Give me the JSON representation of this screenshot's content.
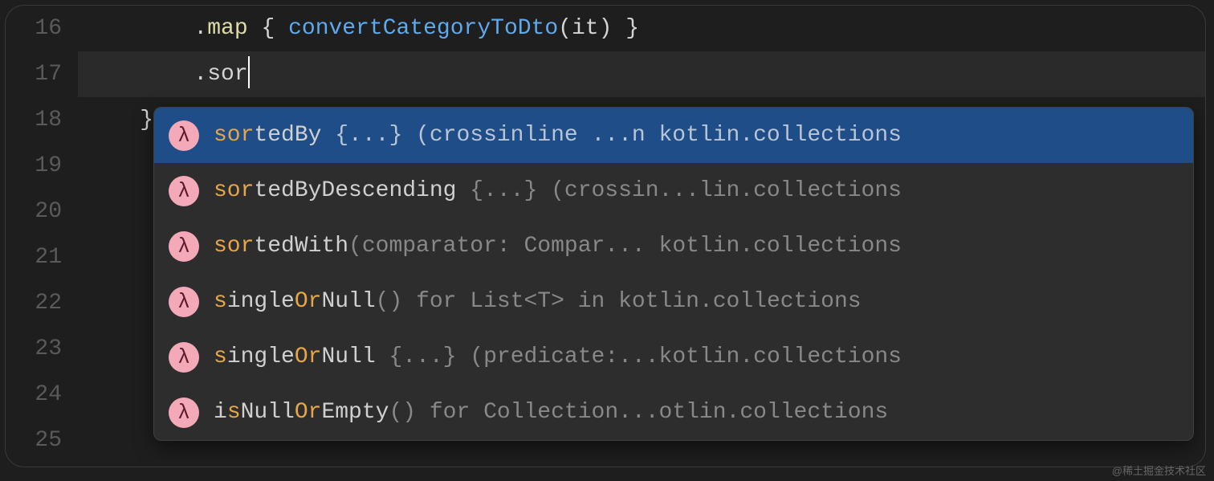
{
  "line_numbers": [
    "16",
    "17",
    "18",
    "19",
    "20",
    "21",
    "22",
    "23",
    "24",
    "25"
  ],
  "code": {
    "line16": {
      "indent": "        ",
      "dot": ".",
      "method": "map",
      "space": " ",
      "lbrace": "{",
      "space2": " ",
      "func": "convertCategoryToDto",
      "lparen": "(",
      "param": "it",
      "rparen": ")",
      "space3": " ",
      "rbrace": "}"
    },
    "line17": {
      "indent": "        ",
      "dot": ".",
      "typed": "sor"
    },
    "line18": {
      "indent": "    ",
      "brace": "}"
    }
  },
  "popup": {
    "lambda_glyph": "λ",
    "items": [
      {
        "match": "sor",
        "rest": "tedBy",
        "sig": " {...} (crossinline ...n kotlin.collections",
        "selected": true
      },
      {
        "match": "sor",
        "rest": "tedByDescending",
        "sig": " {...} (crossin...lin.collections",
        "selected": false
      },
      {
        "match": "sor",
        "rest": "tedWith",
        "sig": "(comparator: Compar... kotlin.collections",
        "selected": false
      },
      {
        "match_parts": [
          "s",
          "ingle",
          "O",
          "r",
          "Null"
        ],
        "match_flags": [
          true,
          false,
          true,
          true,
          false
        ],
        "sig": "() for List<T> in kotlin.collections",
        "selected": false
      },
      {
        "match_parts": [
          "s",
          "ingle",
          "O",
          "r",
          "Null"
        ],
        "match_flags": [
          true,
          false,
          true,
          true,
          false
        ],
        "sig": " {...} (predicate:...kotlin.collections",
        "selected": false
      },
      {
        "match_parts": [
          "i",
          "s",
          "Null",
          "Or",
          "Empty"
        ],
        "match_flags": [
          false,
          true,
          false,
          true,
          false
        ],
        "sig": "() for Collection...otlin.collections",
        "selected": false
      }
    ]
  },
  "watermark": "@稀土掘金技术社区"
}
